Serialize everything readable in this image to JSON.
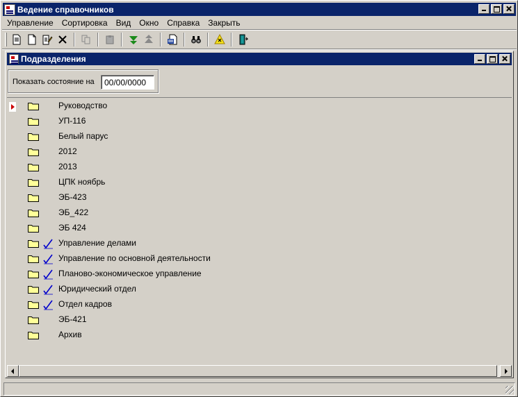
{
  "app": {
    "title": "Ведение справочников"
  },
  "menu": [
    {
      "label": "Управление"
    },
    {
      "label": "Сортировка"
    },
    {
      "label": "Вид"
    },
    {
      "label": "Окно"
    },
    {
      "label": "Справка"
    },
    {
      "label": "Закрыть"
    }
  ],
  "toolbar": {
    "buttons": [
      "new-record-icon",
      "new-document-icon",
      "edit-icon",
      "delete-icon",
      "copy-icon",
      "paste-icon",
      "move-down-icon",
      "move-up-icon",
      "export-icon",
      "find-icon",
      "warning-icon",
      "exit-icon"
    ]
  },
  "child_window": {
    "title": "Подразделения"
  },
  "filter": {
    "label": "Показать состояние на",
    "date_value": "00/00/0000"
  },
  "tree": {
    "items": [
      {
        "label": "Руководство",
        "checked": false,
        "current": true
      },
      {
        "label": "УП-116",
        "checked": false
      },
      {
        "label": "Белый парус",
        "checked": false
      },
      {
        "label": "2012",
        "checked": false
      },
      {
        "label": "2013",
        "checked": false
      },
      {
        "label": "ЦПК ноябрь",
        "checked": false
      },
      {
        "label": "ЭБ-423",
        "checked": false
      },
      {
        "label": "ЭБ_422",
        "checked": false
      },
      {
        "label": "ЭБ 424",
        "checked": false
      },
      {
        "label": "Управление делами",
        "checked": true
      },
      {
        "label": "Управление по основной деятельности",
        "checked": true
      },
      {
        "label": "Планово-экономическое управление",
        "checked": true
      },
      {
        "label": "Юридический отдел",
        "checked": true
      },
      {
        "label": "Отдел кадров",
        "checked": true
      },
      {
        "label": "ЭБ-421",
        "checked": false
      },
      {
        "label": "Архив",
        "checked": false
      }
    ]
  },
  "colors": {
    "title_bg": "#0a246a",
    "window_bg": "#d4d0c8",
    "folder": "#ffff99",
    "check": "#0000cc"
  }
}
